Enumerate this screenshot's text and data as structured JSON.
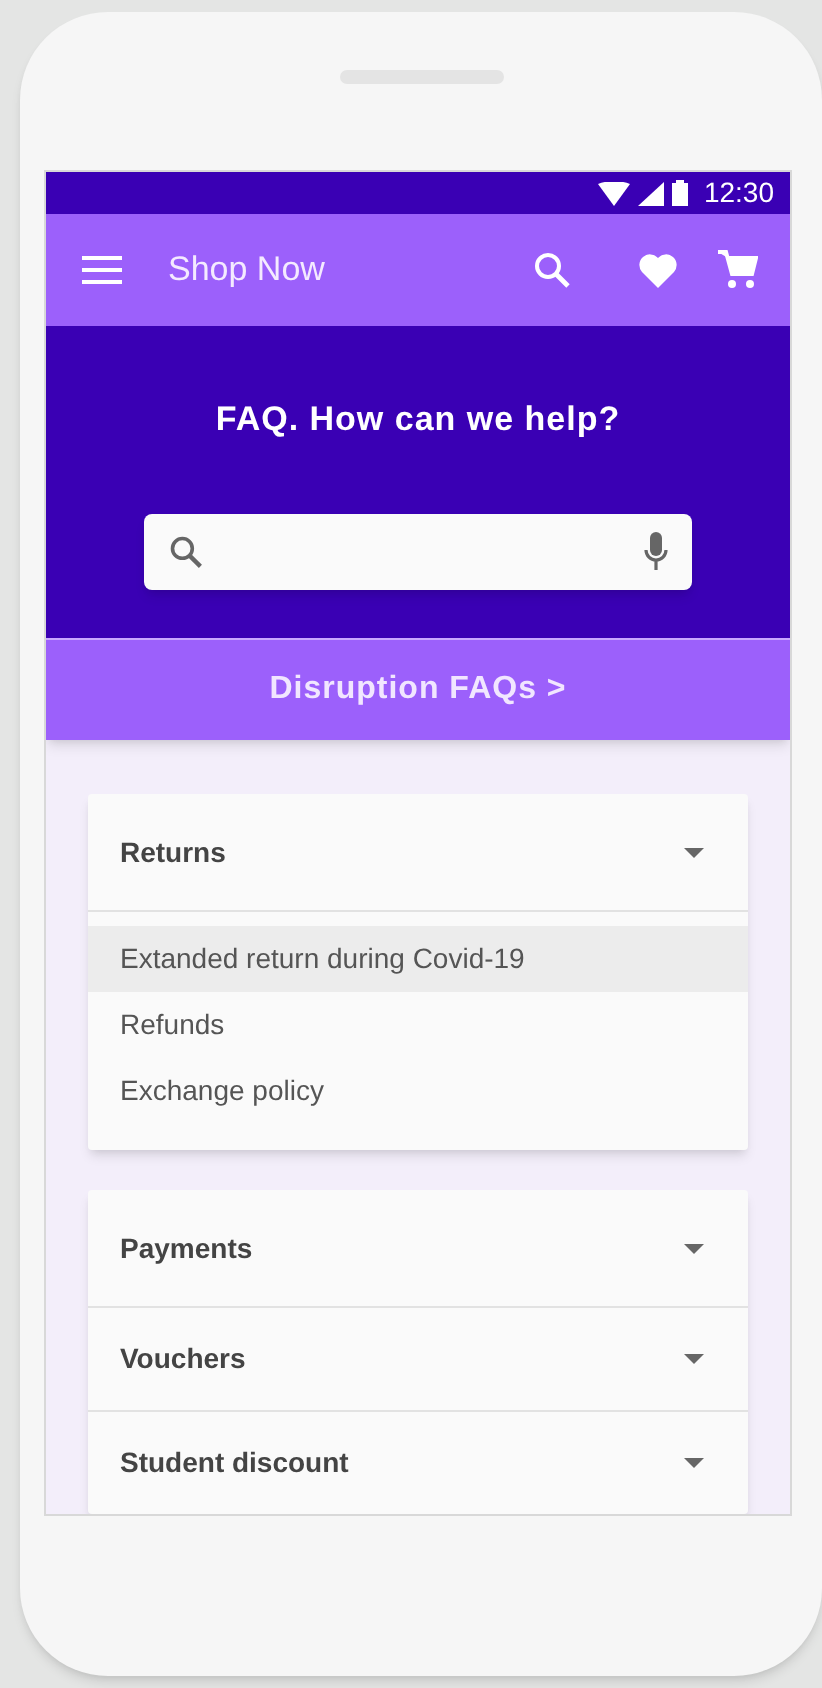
{
  "status_bar": {
    "time": "12:30"
  },
  "app_bar": {
    "title": "Shop Now"
  },
  "hero": {
    "title": "FAQ. How can we help?"
  },
  "disruption_link": {
    "label": "Disruption FAQs >"
  },
  "cards": [
    {
      "sections": [
        {
          "title": "Returns",
          "items": [
            {
              "label": "Extanded return during Covid-19",
              "selected": true
            },
            {
              "label": "Refunds",
              "selected": false
            },
            {
              "label": "Exchange policy",
              "selected": false
            }
          ]
        }
      ]
    },
    {
      "sections": [
        {
          "title": "Payments"
        },
        {
          "title": "Vouchers"
        },
        {
          "title": "Student discount"
        }
      ]
    }
  ]
}
